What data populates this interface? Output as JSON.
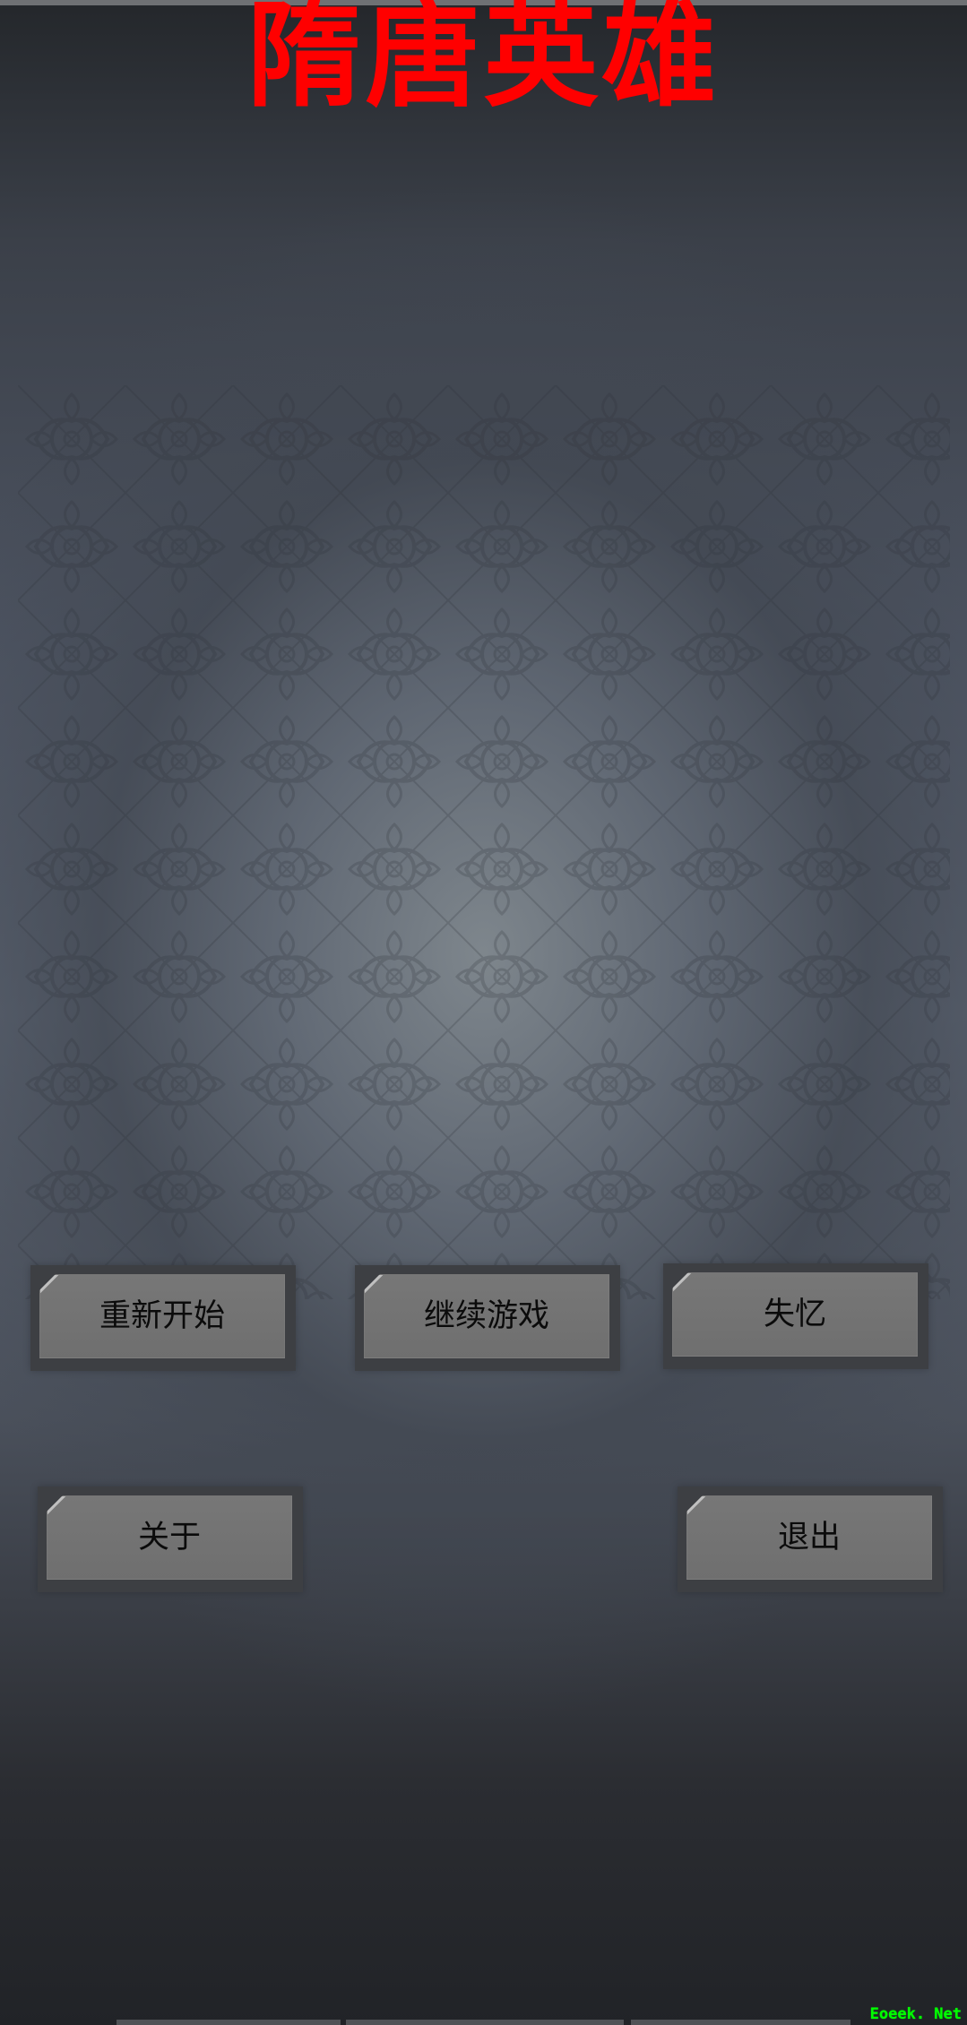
{
  "title": "隋唐英雄",
  "buttons": {
    "restart": "重新开始",
    "continue": "继续游戏",
    "amnesia": "失忆",
    "about": "关于",
    "exit": "退出"
  },
  "watermark": "Eoeek. Net",
  "colors": {
    "title": "#ff0000",
    "button_face": "#777777",
    "button_frame": "#3d3f43",
    "button_text": "#0b0b0b",
    "watermark": "#00ff00"
  },
  "icons": [
    "auspicious-cloud-pattern"
  ]
}
